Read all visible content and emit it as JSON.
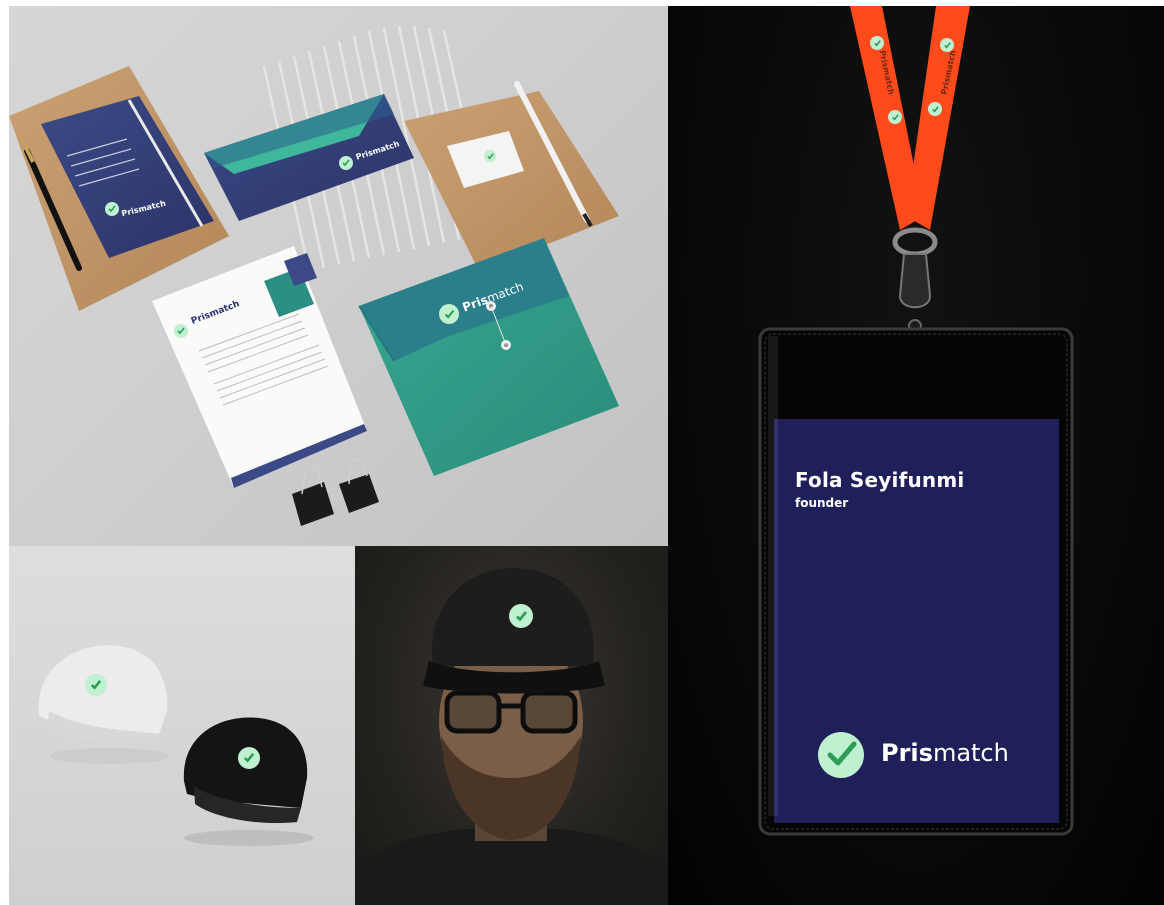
{
  "badge": {
    "name": "Fola Seyifunmi",
    "role": "founder",
    "brand_bold": "Pris",
    "brand_light": "match"
  },
  "stationery": {
    "notebook_brand": "Prismatch",
    "envelope_brand": "Prismatch",
    "letterhead_brand": "Prismatch",
    "folder_brand_bold": "Pris",
    "folder_brand_light": "match"
  },
  "lanyard": {
    "strap_text": "Prismatch"
  },
  "icons": {
    "logo": "check-circle-icon",
    "clip": "binder-clip-icon"
  },
  "colors": {
    "navy": "#1f2059",
    "teal": "#2f9a86",
    "mint": "#bff0cf",
    "green_check": "#2e9c55",
    "lanyard_orange": "#ff4a1c"
  }
}
